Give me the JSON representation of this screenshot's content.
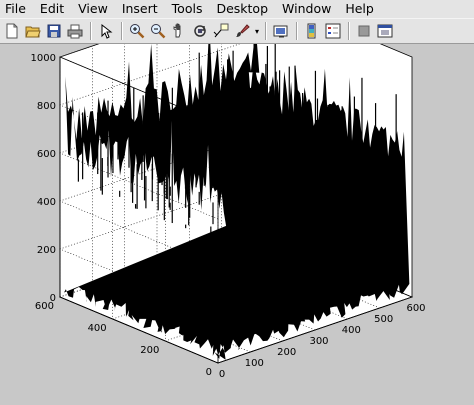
{
  "menu": {
    "file": "File",
    "edit": "Edit",
    "view": "View",
    "insert": "Insert",
    "tools": "Tools",
    "desktop": "Desktop",
    "window": "Window",
    "help": "Help"
  },
  "toolbar": {
    "buttons": [
      "new-figure-icon",
      "open-file-icon",
      "save-figure-icon",
      "print-figure-icon",
      "edit-plot-icon",
      "zoom-in-icon",
      "zoom-out-icon",
      "pan-icon",
      "rotate-3d-icon",
      "data-cursor-icon",
      "brush-icon",
      "link-plot-icon",
      "colorbar-icon",
      "legend-icon",
      "hide-plot-tools-icon",
      "show-plot-tools-icon"
    ]
  },
  "plot": {
    "type": "3d-bar",
    "z_ticks": [
      "0",
      "200",
      "400",
      "600",
      "800",
      "1000"
    ],
    "x_ticks": [
      "0",
      "100",
      "200",
      "300",
      "400",
      "500",
      "600"
    ],
    "y_ticks": [
      "0",
      "200",
      "400",
      "600"
    ],
    "colors": {
      "bars": "#000000",
      "axes_bg": "#ffffff",
      "figure_bg": "#c8c8c8"
    }
  },
  "chart_data": {
    "type": "bar",
    "title": "",
    "xlabel": "",
    "ylabel": "",
    "zlabel": "",
    "xlim": [
      0,
      600
    ],
    "ylim": [
      0,
      600
    ],
    "zlim": [
      0,
      1000
    ],
    "grid": true
  }
}
